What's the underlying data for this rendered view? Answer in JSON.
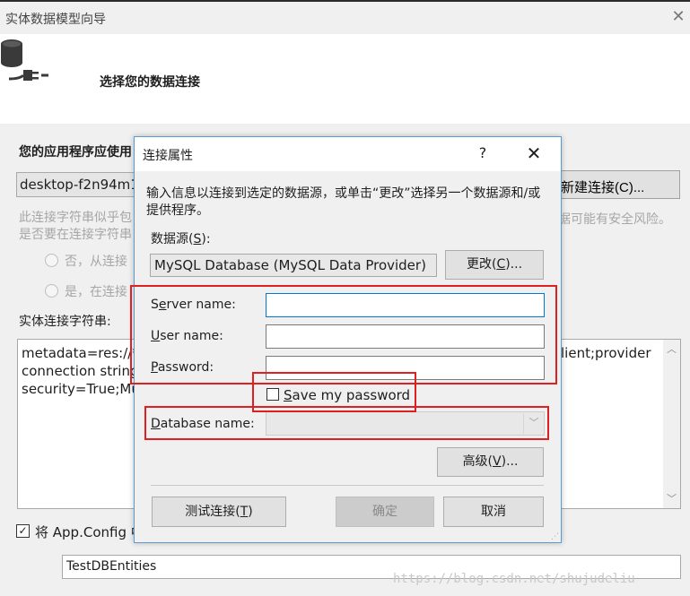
{
  "wizard": {
    "title": "实体数据模型向导",
    "close_glyph": "✕",
    "heading": "选择您的数据连接",
    "app_conn_label": "您的应用程序应使用",
    "conn_combo_value": "desktop-f2n94m1",
    "new_conn_button": "新建连接(C)...",
    "warning_left_1": "此连接字符串似乎包",
    "warning_left_2": "是否要在连接字符串",
    "warning_right": "据可能有安全风险。",
    "radio_no": "否，从连接",
    "radio_yes": "是，在连接",
    "entity_conn_label": "实体连接字符串:",
    "conn_text_left": [
      "metadata=res://*",
      "connection string",
      "security=True;Mu"
    ],
    "conn_text_right": "lient;provider",
    "save_config_label": "将 App.Config 中",
    "save_config_checked": true,
    "entities_name": "TestDBEntities",
    "watermark": "https://blog.csdn.net/shujudeliu"
  },
  "dialog": {
    "title": "连接属性",
    "help_glyph": "?",
    "close_glyph": "✕",
    "description": "输入信息以连接到选定的数据源，或单击“更改”选择另一个数据源和/或提供程序。",
    "datasource_label_pre": "数据源(",
    "datasource_label_key": "S",
    "datasource_label_post": "):",
    "datasource_value": "MySQL Database (MySQL Data Provider)",
    "change_pre": "更改(",
    "change_key": "C",
    "change_post": ")...",
    "server_pre": "S",
    "server_key": "e",
    "server_post": "rver name:",
    "server_value": "",
    "user_key": "U",
    "user_post": "ser name:",
    "user_value": "",
    "password_key": "P",
    "password_post": "assword:",
    "password_value": "",
    "savepw_key": "S",
    "savepw_post": "ave my password",
    "savepw_checked": false,
    "db_key": "D",
    "db_post": "atabase name:",
    "db_value": "",
    "advanced_pre": "高级(",
    "advanced_key": "V",
    "advanced_post": ")...",
    "test_pre": "测试连接(",
    "test_key": "T",
    "test_post": ")",
    "ok": "确定",
    "cancel": "取消"
  },
  "colors": {
    "highlight_red": "#e02020",
    "focus_blue": "#0078d7",
    "dialog_border": "#5a9bd4"
  }
}
